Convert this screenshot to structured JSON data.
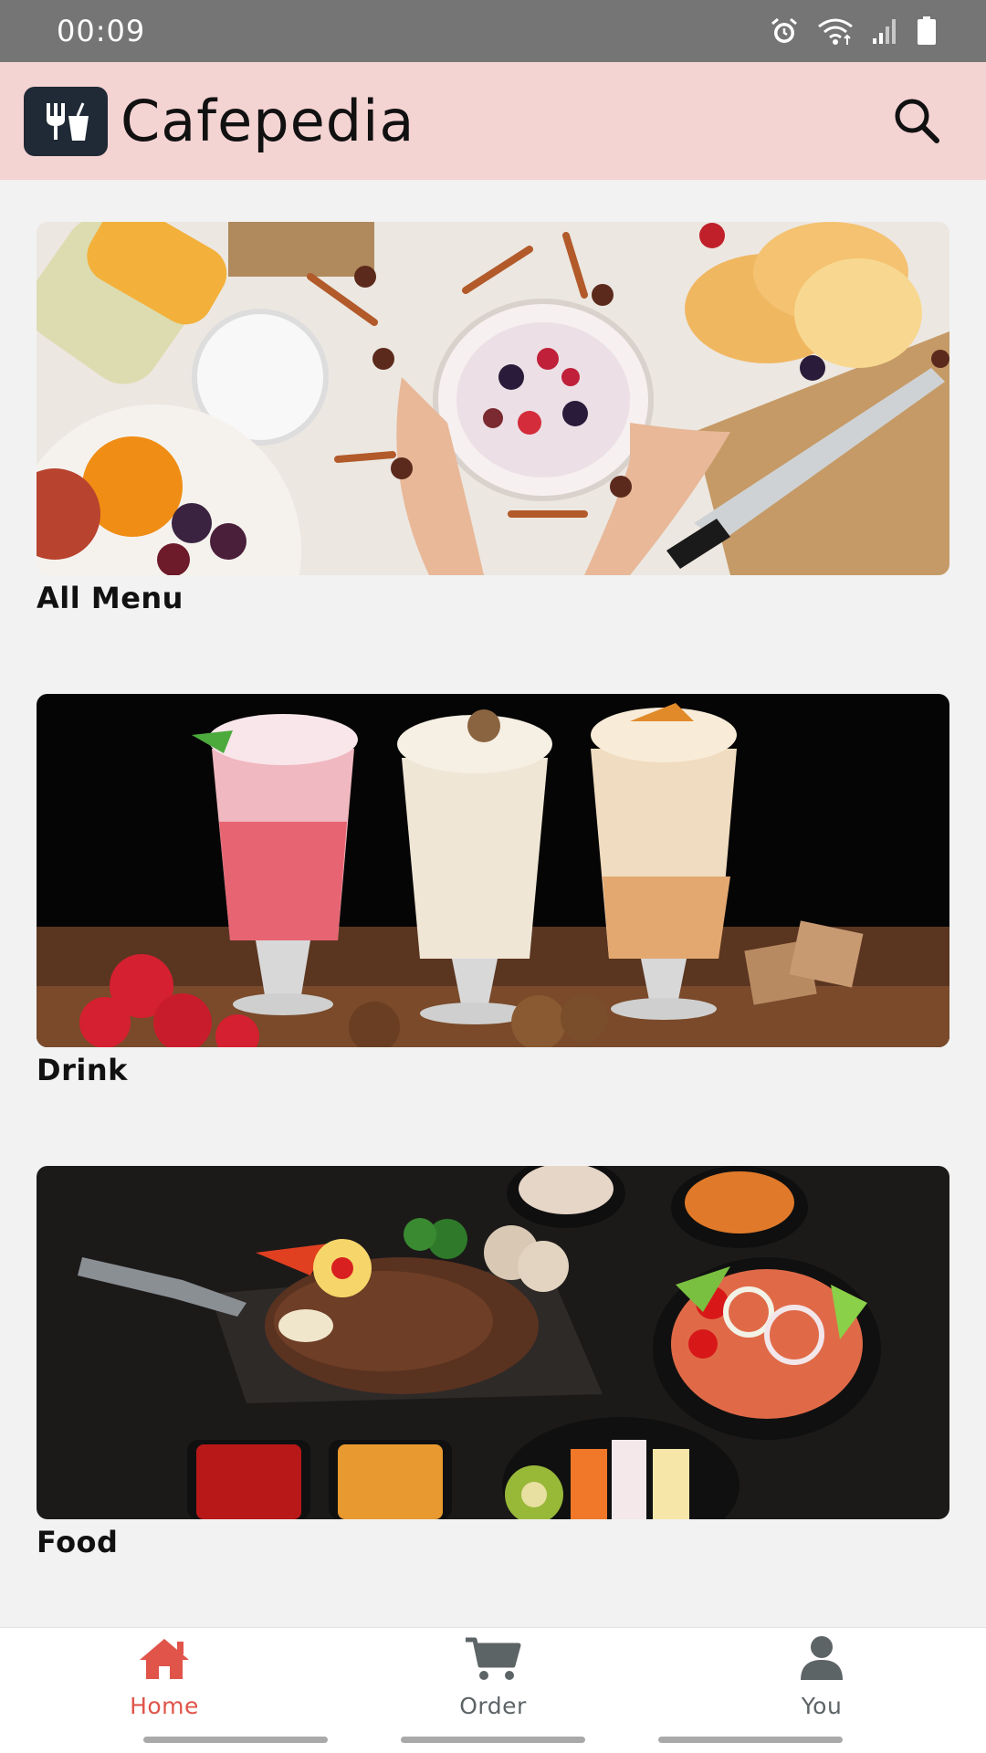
{
  "status_bar": {
    "time": "00:09",
    "icons": [
      "alarm-icon",
      "wifi-icon",
      "signal-icon",
      "battery-icon"
    ]
  },
  "app_bar": {
    "title": "Cafepedia",
    "logo_icon": "fork-and-cup-icon",
    "search_icon": "search-icon",
    "background": "#f4d3d3"
  },
  "categories": [
    {
      "label": "All Menu"
    },
    {
      "label": "Drink"
    },
    {
      "label": "Food"
    }
  ],
  "bottom_nav": {
    "items": [
      {
        "label": "Home",
        "icon": "home-icon",
        "active": true
      },
      {
        "label": "Order",
        "icon": "cart-icon",
        "active": false
      },
      {
        "label": "You",
        "icon": "person-icon",
        "active": false
      }
    ],
    "active_color": "#e0544a",
    "inactive_color": "#5d6466"
  }
}
